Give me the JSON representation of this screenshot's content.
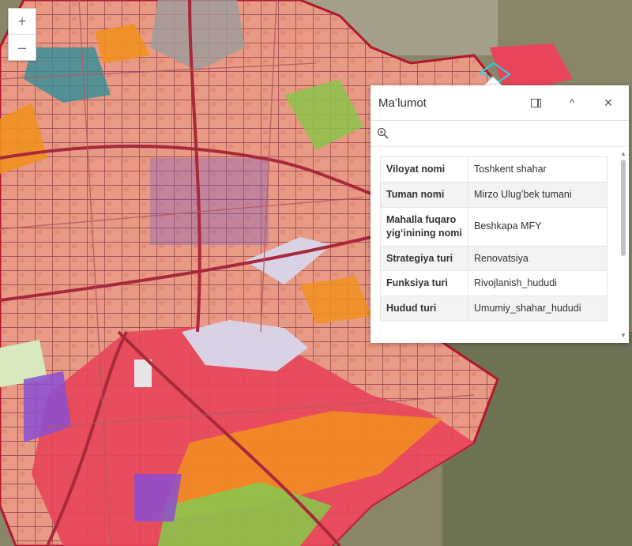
{
  "zoom": {
    "in_label": "+",
    "out_label": "–"
  },
  "popup": {
    "title": "Maʻlumot",
    "collapse_icon": "^",
    "close_icon": "×",
    "rows": [
      {
        "key": "Viloyat nomi",
        "value": "Toshkent shahar"
      },
      {
        "key": "Tuman nomi",
        "value": "Mirzo Ulugʻbek tumani"
      },
      {
        "key": "Mahalla fuqaro yigʻinining nomi",
        "value": "Beshkapa MFY"
      },
      {
        "key": "Strategiya turi",
        "value": "Renovatsiya"
      },
      {
        "key": "Funksiya turi",
        "value": "Rivojlanish_hududi"
      },
      {
        "key": "Hudud turi",
        "value": "Umumiy_shahar_hududi"
      }
    ]
  },
  "colors": {
    "residential": "#e89a84",
    "commercial": "#f1901f",
    "industrial": "#e8455a",
    "park": "#8cc44b",
    "public": "#8a4fd1",
    "road": "#a8283c",
    "water": "#d9d2e4",
    "gray": "#9c9c9c",
    "teal": "#2f8f98",
    "selection": "#29d3e0"
  }
}
